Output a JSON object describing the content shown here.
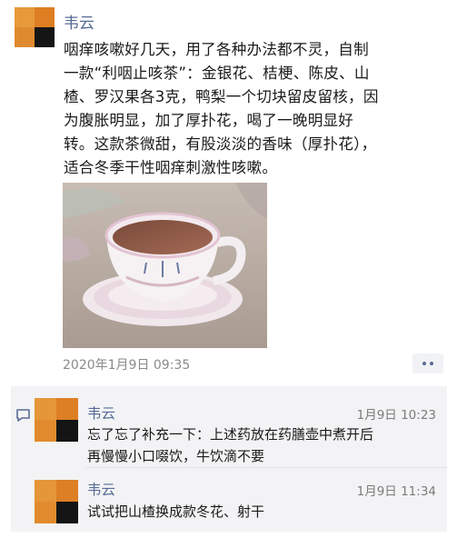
{
  "post": {
    "author": "韦云",
    "paragraph_lines": [
      "咽痒咳嗽好几天，用了各种办法都不灵，自制",
      "一款“利咽止咳茶”：金银花、桔梗、陈皮、山",
      "楂、罗汉果各3克，鸭梨一个切块留皮留核，因",
      "为腹胀明显，加了厚扑花，喝了一晚明显好",
      "转。这款茶微甜，有股淡淡的香味（厚扑花），",
      "适合冬季干性咽痒刺激性咳嗽。"
    ],
    "timestamp": "2020年1月9日 09:35"
  },
  "comments": [
    {
      "author": "韦云",
      "time": "1月9日 10:23",
      "lines": [
        "忘了忘了补充一下：上述药放在药膳壶中煮开后",
        "再慢慢小口啜饮，牛饮滴不要"
      ]
    },
    {
      "author": "韦云",
      "time": "1月9日 11:34",
      "lines": [
        "试试把山楂换成款冬花、射干"
      ]
    }
  ],
  "icons": {
    "more": "more-dots-icon",
    "comment": "comment-bubble-icon"
  },
  "colors": {
    "name_link": "#576b95",
    "comment_bg": "#f3f3f5",
    "avatar_orange": "#e3862a",
    "avatar_dark": "#141414"
  }
}
